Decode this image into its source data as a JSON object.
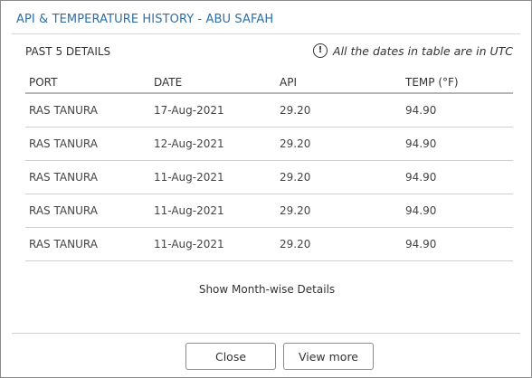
{
  "dialog": {
    "title": "API & TEMPERATURE HISTORY - ABU SAFAH",
    "subheading": "PAST 5 DETAILS",
    "note_icon": "info-icon",
    "note_icon_glyph": "!",
    "note": "All the dates in table are in UTC"
  },
  "table": {
    "columns": [
      "PORT",
      "DATE",
      "API",
      "TEMP (°F)"
    ],
    "rows": [
      [
        "RAS TANURA",
        "17-Aug-2021",
        "29.20",
        "94.90"
      ],
      [
        "RAS TANURA",
        "12-Aug-2021",
        "29.20",
        "94.90"
      ],
      [
        "RAS TANURA",
        "11-Aug-2021",
        "29.20",
        "94.90"
      ],
      [
        "RAS TANURA",
        "11-Aug-2021",
        "29.20",
        "94.90"
      ],
      [
        "RAS TANURA",
        "11-Aug-2021",
        "29.20",
        "94.90"
      ]
    ]
  },
  "link": {
    "monthwise": "Show Month-wise Details"
  },
  "buttons": {
    "close": "Close",
    "view_more": "View more"
  },
  "colors": {
    "title": "#2a6fa8",
    "border": "#8a8a8a",
    "text": "#333333"
  }
}
